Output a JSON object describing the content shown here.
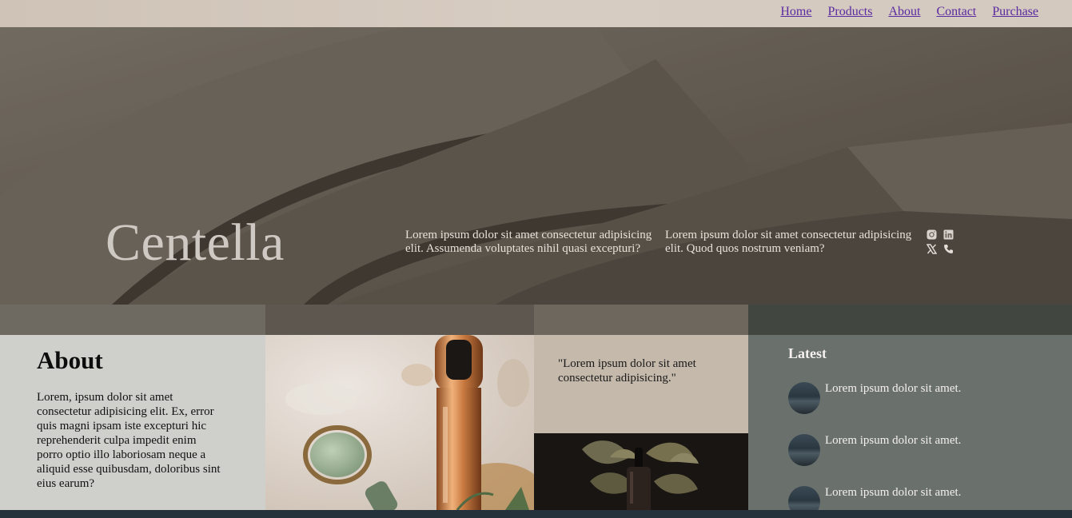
{
  "nav": {
    "items": [
      {
        "label": "Home"
      },
      {
        "label": "Products"
      },
      {
        "label": "About"
      },
      {
        "label": "Contact"
      },
      {
        "label": "Purchase"
      }
    ],
    "link_color": "#5a2aa0"
  },
  "hero": {
    "brand": "Centella",
    "text_1": "Lorem ipsum dolor sit amet consectetur adipisicing elit. Assumenda voluptates nihil quasi excepturi?",
    "text_2": "Lorem ipsum dolor sit amet consectetur adipisicing elit. Quod quos nostrum veniam?",
    "socials": [
      "instagram-icon",
      "linkedin-icon",
      "x-icon",
      "phone-icon"
    ]
  },
  "about": {
    "title": "About",
    "body": "Lorem, ipsum dolor sit amet consectetur adipisicing elit. Ex, error quis magni ipsam iste excepturi hic reprehenderit culpa impedit enim porro optio illo laboriosam neque a aliquid esse quibusdam, doloribus sint eius earum?"
  },
  "quote": {
    "text": "\"Lorem ipsum dolor sit amet consectetur adipisicing.\""
  },
  "latest": {
    "title": "Latest",
    "items": [
      {
        "text": "Lorem ipsum dolor sit amet."
      },
      {
        "text": "Lorem ipsum dolor sit amet."
      },
      {
        "text": "Lorem ipsum dolor sit amet."
      }
    ]
  },
  "colors": {
    "about_bg": "#cfd0cb",
    "quote_bg": "#c4b9ab",
    "latest_bg": "#6a706c",
    "hero_bg": "#625a50"
  }
}
